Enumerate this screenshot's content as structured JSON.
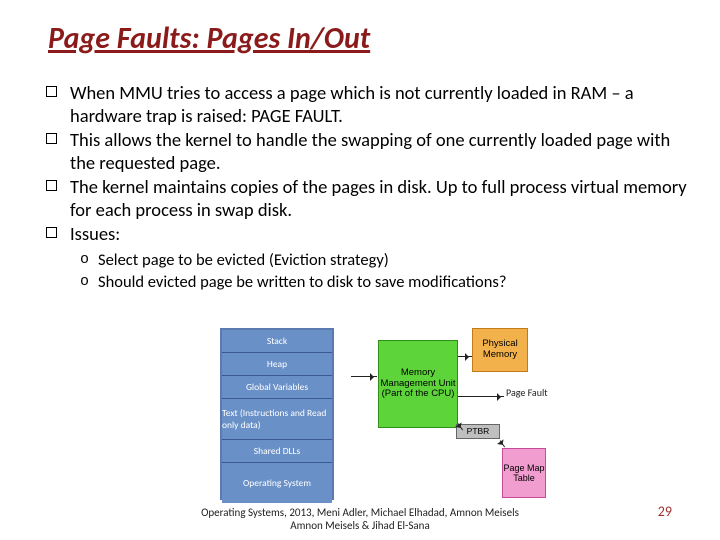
{
  "title": "Page Faults: Pages In/Out",
  "bullets": [
    "When MMU tries to access a page which is not currently loaded in RAM – a hardware trap is raised: PAGE FAULT.",
    "This allows the kernel to handle the swapping of one currently loaded page with the requested page.",
    "The kernel maintains copies of the pages in disk.  Up to full process virtual memory for each process in swap disk.",
    "Issues:"
  ],
  "sub_bullets": [
    "Select page to be evicted (Eviction strategy)",
    "Should evicted page be written to disk to save modifications?"
  ],
  "diagram": {
    "blue_rows": [
      "Stack",
      "Heap",
      "Global Variables",
      "Text (Instructions and Read only data)",
      "Shared DLLs",
      "Operating System"
    ],
    "green": "Memory Management Unit (Part of the CPU)",
    "orange": "Physical Memory",
    "pink": "Page Map Table",
    "ptbr": "PTBR",
    "pagefault": "Page Fault"
  },
  "footer": {
    "line1": "Operating Systems, 2013, Meni Adler, Michael Elhadad, Amnon Meisels",
    "line2": "Amnon Meisels  & Jihad El-Sana"
  },
  "page_number": "29"
}
